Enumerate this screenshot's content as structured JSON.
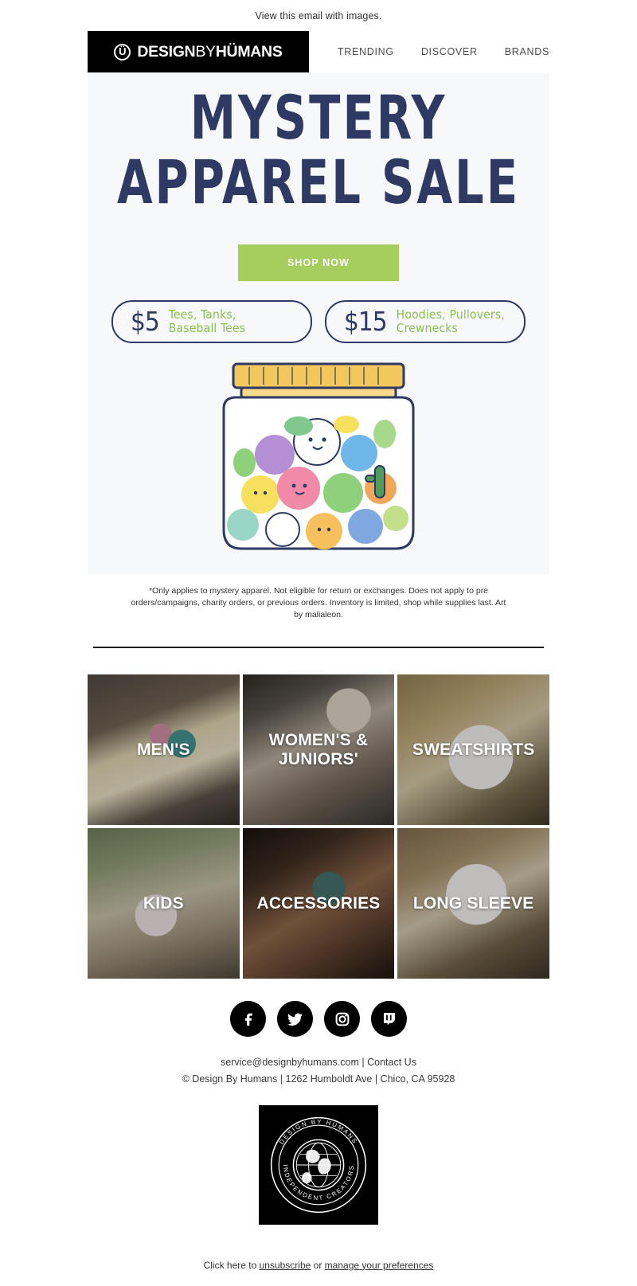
{
  "preheader": {
    "text": "View this email with images."
  },
  "header": {
    "logo": {
      "mark_glyph": "Ü",
      "word1": "DESIGN",
      "word2": "BY",
      "word3": "HÜMANS",
      "icon": "smiley-circle-icon"
    },
    "nav": [
      {
        "label": "TRENDING"
      },
      {
        "label": "DISCOVER"
      },
      {
        "label": "BRANDS"
      }
    ]
  },
  "hero": {
    "title_line1": "MYSTERY",
    "title_line2": "APPAREL SALE",
    "cta_label": "SHOP NOW",
    "title_color": "#2e3a63",
    "cta_color": "#a5ce5f",
    "background": "#f7f8fa",
    "prices": [
      {
        "amount": "$5",
        "desc_line1": "Tees, Tanks,",
        "desc_line2": "Baseball Tees"
      },
      {
        "amount": "$15",
        "desc_line1": "Hoodies, Pullovers,",
        "desc_line2": "Crewnecks"
      }
    ],
    "illustration": "mystery-jar-illustration"
  },
  "disclaimer": {
    "text": "*Only applies to mystery apparel. Not eligible for return or exchanges. Does not apply to pre orders/campaigns, charity orders, or previous orders. Inventory is limited, shop while supplies last. Art by malialeon."
  },
  "categories": [
    {
      "label": "MEN'S",
      "image": "mens-photo"
    },
    {
      "label": "WOMEN'S & JUNIORS'",
      "image": "womens-juniors-photo"
    },
    {
      "label": "SWEATSHIRTS",
      "image": "sweatshirts-photo"
    },
    {
      "label": "KIDS",
      "image": "kids-photo"
    },
    {
      "label": "ACCESSORIES",
      "image": "accessories-photo"
    },
    {
      "label": "LONG SLEEVE",
      "image": "long-sleeve-photo"
    }
  ],
  "social": [
    {
      "name": "facebook"
    },
    {
      "name": "twitter"
    },
    {
      "name": "instagram"
    },
    {
      "name": "twitch"
    }
  ],
  "footer": {
    "email": "service@designbyhumans.com",
    "separator": " | ",
    "contact_label": "Contact Us",
    "address": "© Design By Humans | 1262 Humboldt Ave | Chico, CA 95928",
    "seal": {
      "top_text": "DESIGN BY HUMANS",
      "bottom_text": "INDEPENDENT CREATORS"
    }
  },
  "unsubscribe": {
    "prefix": "Click here to ",
    "link1": "unsubscribe",
    "middle": " or ",
    "link2": "manage your preferences"
  }
}
